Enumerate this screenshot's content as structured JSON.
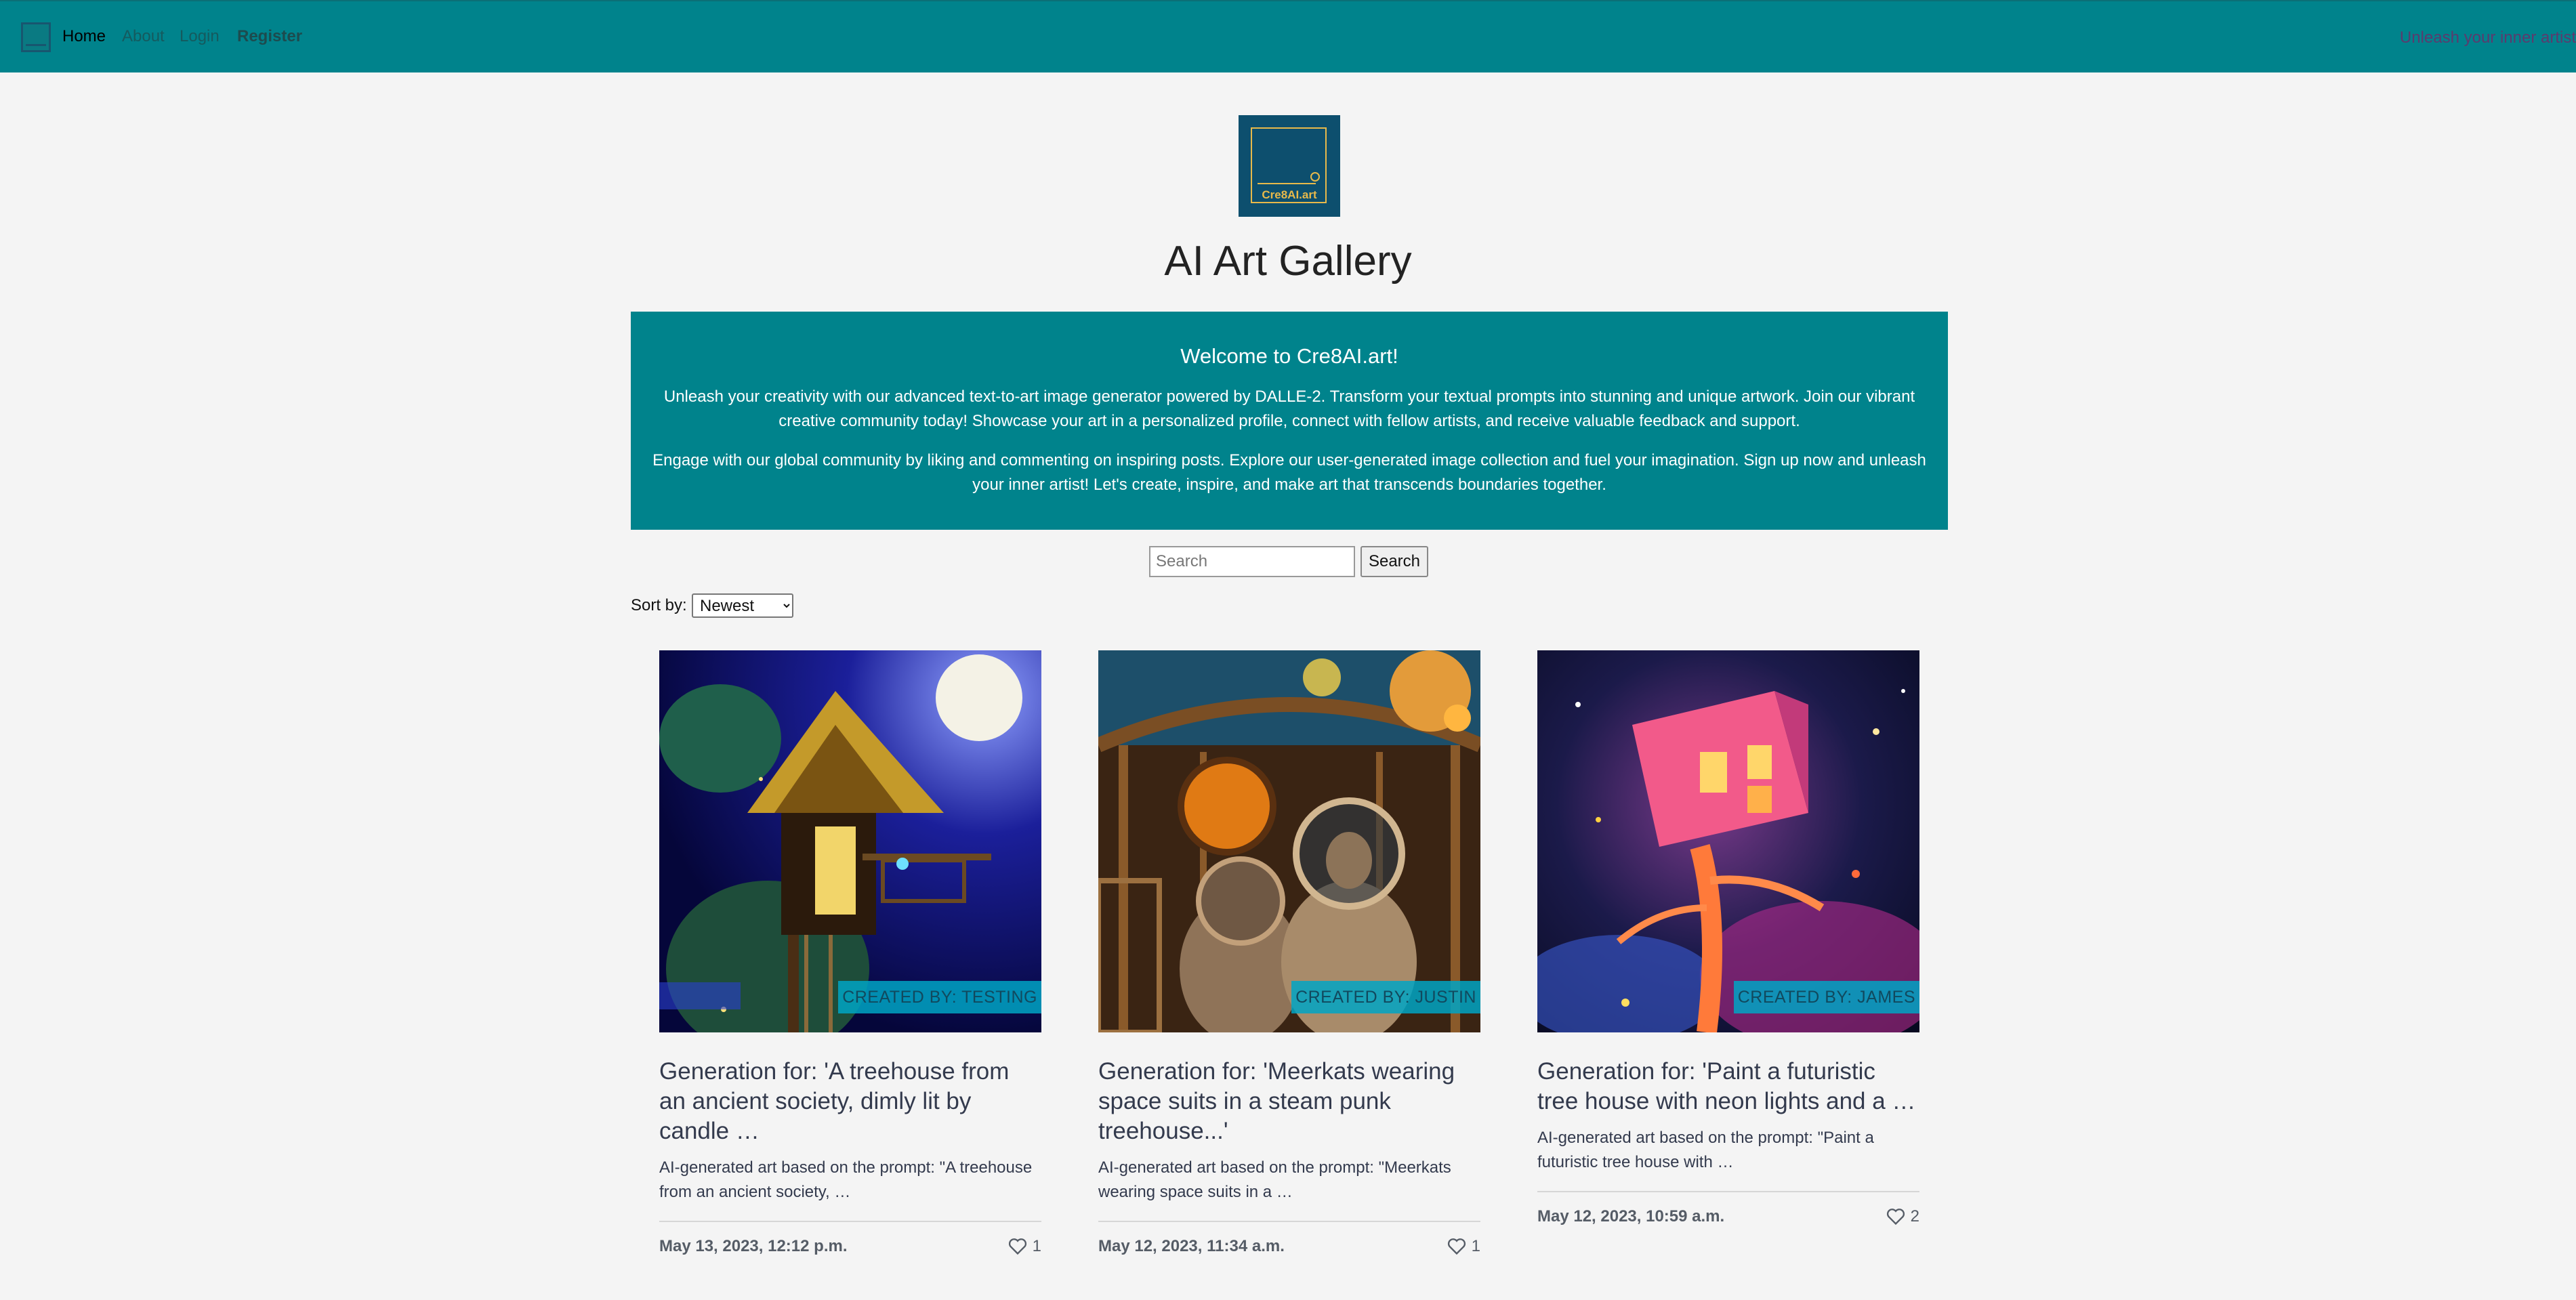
{
  "nav": {
    "home": "Home",
    "about": "About",
    "login": "Login",
    "register": "Register",
    "tagline": "Unleash your inner artist",
    "logo_icon": "brand-mark-icon"
  },
  "brand": {
    "logo_text": "Cre8AI.art"
  },
  "page": {
    "title": "AI Art Gallery"
  },
  "welcome": {
    "heading": "Welcome to Cre8AI.art!",
    "paragraph_1": "Unleash your creativity with our advanced text-to-art image generator powered by DALLE-2. Transform your textual prompts into stunning and unique artwork. Join our vibrant creative community today! Showcase your art in a personalized profile, connect with fellow artists, and receive valuable feedback and support.",
    "paragraph_2": "Engage with our global community by liking and commenting on inspiring posts. Explore our user-generated image collection and fuel your imagination. Sign up now and unleash your inner artist! Let's create, inspire, and make art that transcends boundaries together."
  },
  "search": {
    "placeholder": "Search",
    "button_label": "Search"
  },
  "sort": {
    "label": "Sort by:",
    "selected": "Newest"
  },
  "cards": [
    {
      "badge": "CREATED BY: TESTING",
      "title": "Generation for: 'A treehouse from an ancient society, dimly lit by candle …",
      "description": "AI-generated art based on the prompt: \"A treehouse from an ancient society, …",
      "date": "May 13, 2023, 12:12 p.m.",
      "likes": "1"
    },
    {
      "badge": "CREATED BY: JUSTIN",
      "title": "Generation for: 'Meerkats wearing space suits in a steam punk treehouse...'",
      "description": "AI-generated art based on the prompt: \"Meerkats wearing space suits in a …",
      "date": "May 12, 2023, 11:34 a.m.",
      "likes": "1"
    },
    {
      "badge": "CREATED BY: JAMES",
      "title": "Generation for: 'Paint a futuristic tree house with neon lights and a …",
      "description": "AI-generated art based on the prompt: \"Paint a futuristic tree house with …",
      "date": "May 12, 2023, 10:59 a.m.",
      "likes": "2"
    }
  ],
  "icons": {
    "like": "heart-icon"
  },
  "colors": {
    "navbar": "#00838c",
    "welcome_background": "#00838c",
    "page_background": "#f4f4f4",
    "badge": "#00a4c4",
    "logo_background": "#0d4f6e",
    "logo_accent": "#e8b94a"
  }
}
